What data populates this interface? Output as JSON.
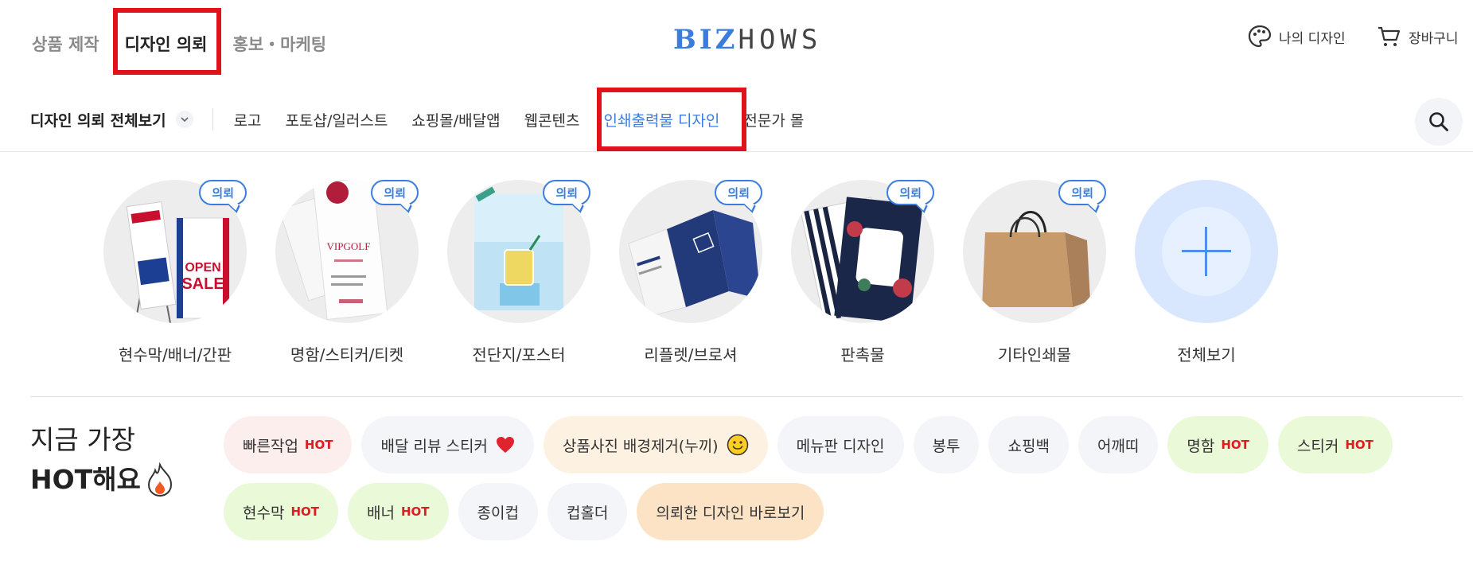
{
  "header": {
    "top_nav": [
      "상품 제작",
      "디자인 의뢰",
      "홍보・마케팅"
    ],
    "logo": {
      "biz": "BIZ",
      "hows": "HOWS"
    },
    "my_design": "나의 디자인",
    "cart": "장바구니"
  },
  "sub_nav": {
    "all_label": "디자인 의뢰 전체보기",
    "items": [
      "로고",
      "포토샵/일러스트",
      "쇼핑몰/배달앱",
      "웹콘텐츠",
      "인쇄출력물 디자인",
      "전문가 몰"
    ]
  },
  "categories": [
    {
      "label": "현수막/배너/간판",
      "badge": "의뢰"
    },
    {
      "label": "명함/스티커/티켓",
      "badge": "의뢰"
    },
    {
      "label": "전단지/포스터",
      "badge": "의뢰"
    },
    {
      "label": "리플렛/브로셔",
      "badge": "의뢰"
    },
    {
      "label": "판촉물",
      "badge": "의뢰"
    },
    {
      "label": "기타인쇄물",
      "badge": "의뢰"
    },
    {
      "label": "전체보기"
    }
  ],
  "art_text": {
    "banner_open": "OPEN",
    "banner_sale": "SALE",
    "card_brand": "VIPGOLF"
  },
  "hot": {
    "title_line1": "지금 가장",
    "title_line2": "HOT해요",
    "hot_tag": "HOT",
    "chips": [
      {
        "label": "빠른작업",
        "hot": true,
        "style": "pink"
      },
      {
        "label": "배달 리뷰 스티커",
        "icon": "heart-icon",
        "style": "gray"
      },
      {
        "label": "상품사진 배경제거(누끼)",
        "icon": "smile-emoji-icon",
        "style": "peach"
      },
      {
        "label": "메뉴판 디자인",
        "style": "gray"
      },
      {
        "label": "봉투",
        "style": "gray"
      },
      {
        "label": "쇼핑백",
        "style": "gray"
      },
      {
        "label": "어깨띠",
        "style": "gray"
      },
      {
        "label": "명함",
        "hot": true,
        "style": "green"
      },
      {
        "label": "스티커",
        "hot": true,
        "style": "green"
      },
      {
        "label": "현수막",
        "hot": true,
        "style": "green"
      },
      {
        "label": "배너",
        "hot": true,
        "style": "green"
      },
      {
        "label": "종이컵",
        "style": "gray"
      },
      {
        "label": "컵홀더",
        "style": "gray"
      },
      {
        "label": "의뢰한 디자인 바로보기",
        "style": "orange"
      }
    ]
  },
  "colors": {
    "accent": "#3b7ddd",
    "highlight_box": "#e0121b",
    "hot": "#e01b22"
  }
}
